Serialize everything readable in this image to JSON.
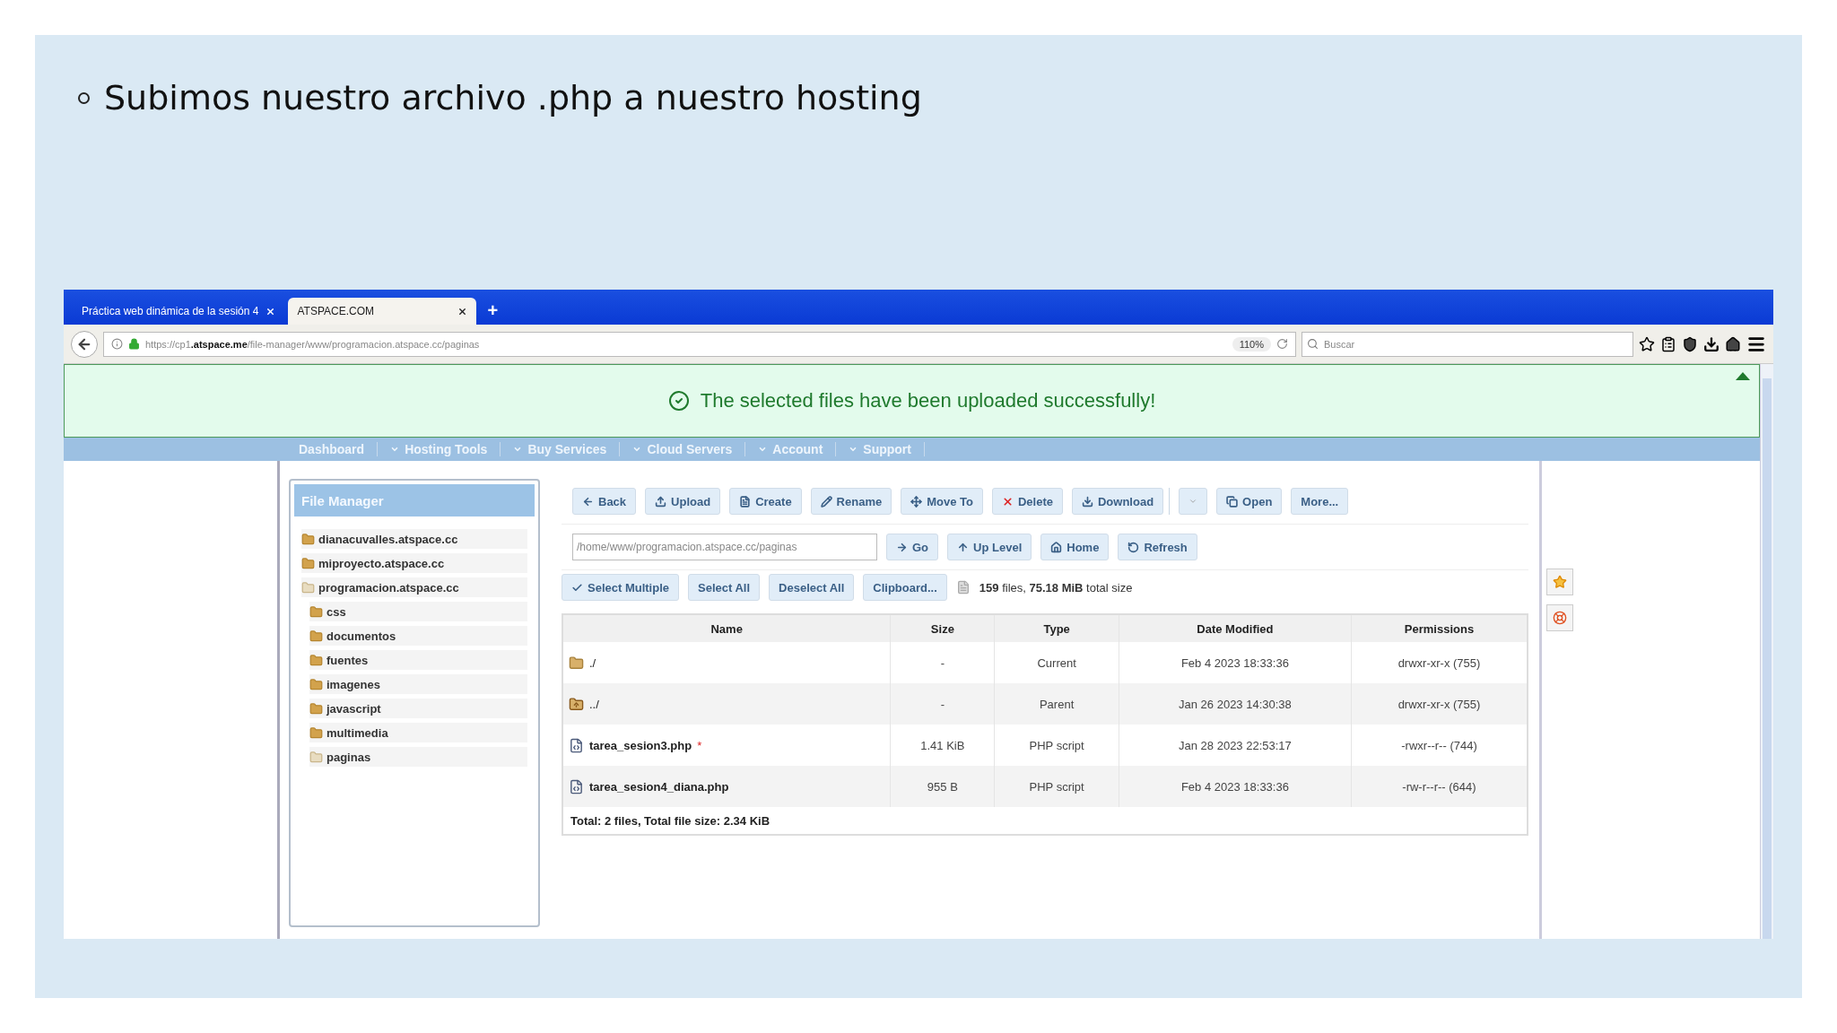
{
  "slide": {
    "bullet": "Subimos nuestro archivo .php a nuestro hosting"
  },
  "browser": {
    "tabs": [
      {
        "label": "Práctica web dinámica de la sesión 4",
        "selected": false
      },
      {
        "label": "ATSPACE.COM",
        "selected": true
      }
    ],
    "new_tab": "+",
    "url": {
      "scheme": "https://cp1",
      "host": ".atspace.me",
      "path": "/file-manager/www/programacion.atspace.cc/paginas"
    },
    "zoom": "110%",
    "search": {
      "placeholder": "Buscar"
    }
  },
  "banner": {
    "message": "The selected files have been uploaded successfully!"
  },
  "nav": [
    {
      "label": "Dashboard",
      "has_menu": false
    },
    {
      "label": "Hosting Tools",
      "has_menu": true
    },
    {
      "label": "Buy Services",
      "has_menu": true
    },
    {
      "label": "Cloud Servers",
      "has_menu": true
    },
    {
      "label": "Account",
      "has_menu": true
    },
    {
      "label": "Support",
      "has_menu": true
    }
  ],
  "sidebar": {
    "title": "File Manager",
    "tree": [
      {
        "label": "dianacuvalles.atspace.cc",
        "expanded": false
      },
      {
        "label": "miproyecto.atspace.cc",
        "expanded": false
      },
      {
        "label": "programacion.atspace.cc",
        "expanded": true,
        "children": [
          {
            "label": "css",
            "expanded": false
          },
          {
            "label": "documentos",
            "expanded": false
          },
          {
            "label": "fuentes",
            "expanded": false
          },
          {
            "label": "imagenes",
            "expanded": false
          },
          {
            "label": "javascript",
            "expanded": false
          },
          {
            "label": "multimedia",
            "expanded": false
          },
          {
            "label": "paginas",
            "expanded": true
          }
        ]
      }
    ]
  },
  "toolbar": [
    {
      "label": "Back",
      "kind": "back"
    },
    {
      "label": "Upload",
      "kind": "upload"
    },
    {
      "label": "Create",
      "kind": "create"
    },
    {
      "label": "Rename",
      "kind": "rename"
    },
    {
      "label": "Move To",
      "kind": "move"
    },
    {
      "label": "Delete",
      "kind": "delete"
    },
    {
      "label": "Download",
      "kind": "download"
    },
    {
      "label": "Open",
      "kind": "open"
    },
    {
      "label": "More...",
      "kind": "more"
    }
  ],
  "path": {
    "value": "/home/www/programacion.atspace.cc/paginas"
  },
  "path_buttons": [
    {
      "label": "Go",
      "kind": "go"
    },
    {
      "label": "Up Level",
      "kind": "up"
    },
    {
      "label": "Home",
      "kind": "home"
    },
    {
      "label": "Refresh",
      "kind": "refresh"
    }
  ],
  "select_buttons": [
    {
      "label": "Select Multiple",
      "kind": "check"
    },
    {
      "label": "Select All",
      "kind": "plain"
    },
    {
      "label": "Deselect All",
      "kind": "plain"
    },
    {
      "label": "Clipboard...",
      "kind": "plain"
    }
  ],
  "summary": "**159** files, **75.18 MiB** total size",
  "table": {
    "columns": [
      "Name",
      "Size",
      "Type",
      "Date Modified",
      "Permissions"
    ],
    "rows": [
      {
        "kind": "folder",
        "name": "./",
        "size": "-",
        "type": "Current",
        "date": "Feb 4 2023 18:33:36",
        "permissions": "drwxr-xr-x (755)"
      },
      {
        "kind": "parent",
        "name": "../",
        "size": "-",
        "type": "Parent",
        "date": "Jan 26 2023 14:30:38",
        "permissions": "drwxr-xr-x (755)"
      },
      {
        "kind": "php",
        "name": "tarea_sesion3.php",
        "mark": "*",
        "size": "1.41 KiB",
        "type": "PHP script",
        "date": "Jan 28 2023 22:53:17",
        "permissions": "-rwxr--r-- (744)"
      },
      {
        "kind": "php",
        "name": "tarea_sesion4_diana.php",
        "size": "955 B",
        "type": "PHP script",
        "date": "Feb 4 2023 18:33:36",
        "permissions": "-rw-r--r-- (644)"
      }
    ],
    "footer": "Total: 2 files, Total file size: 2.34 KiB"
  }
}
